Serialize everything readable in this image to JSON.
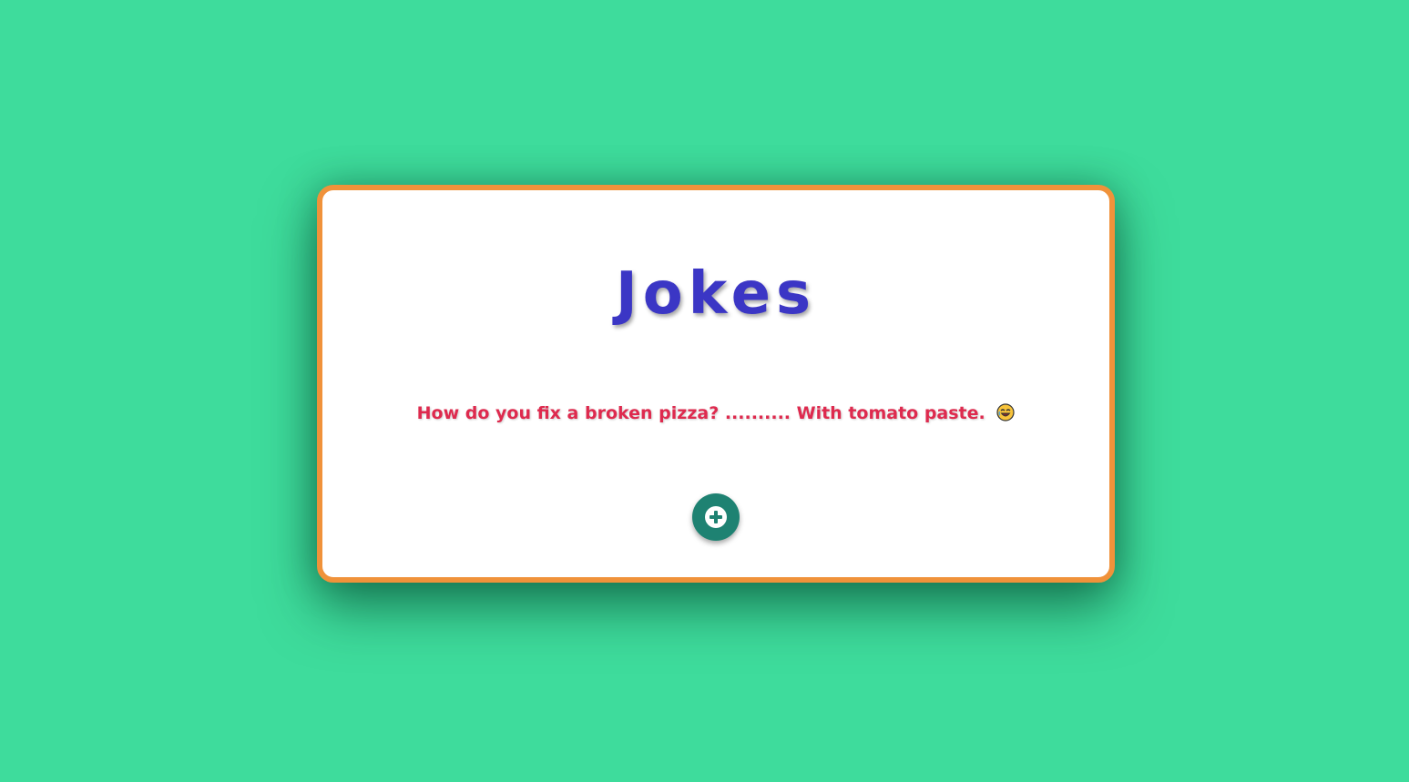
{
  "page": {
    "title": "Jokes",
    "joke_text": "How do you fix a broken pizza? .......... With tomato paste.",
    "joke_emoji_icon": "laughing-face-icon",
    "add_button_icon": "plus-circle-icon"
  },
  "colors": {
    "background": "#3edc9c",
    "card_border": "#f0923a",
    "title": "#3b36c5",
    "joke": "#de2a4e",
    "button": "#1e8272"
  }
}
